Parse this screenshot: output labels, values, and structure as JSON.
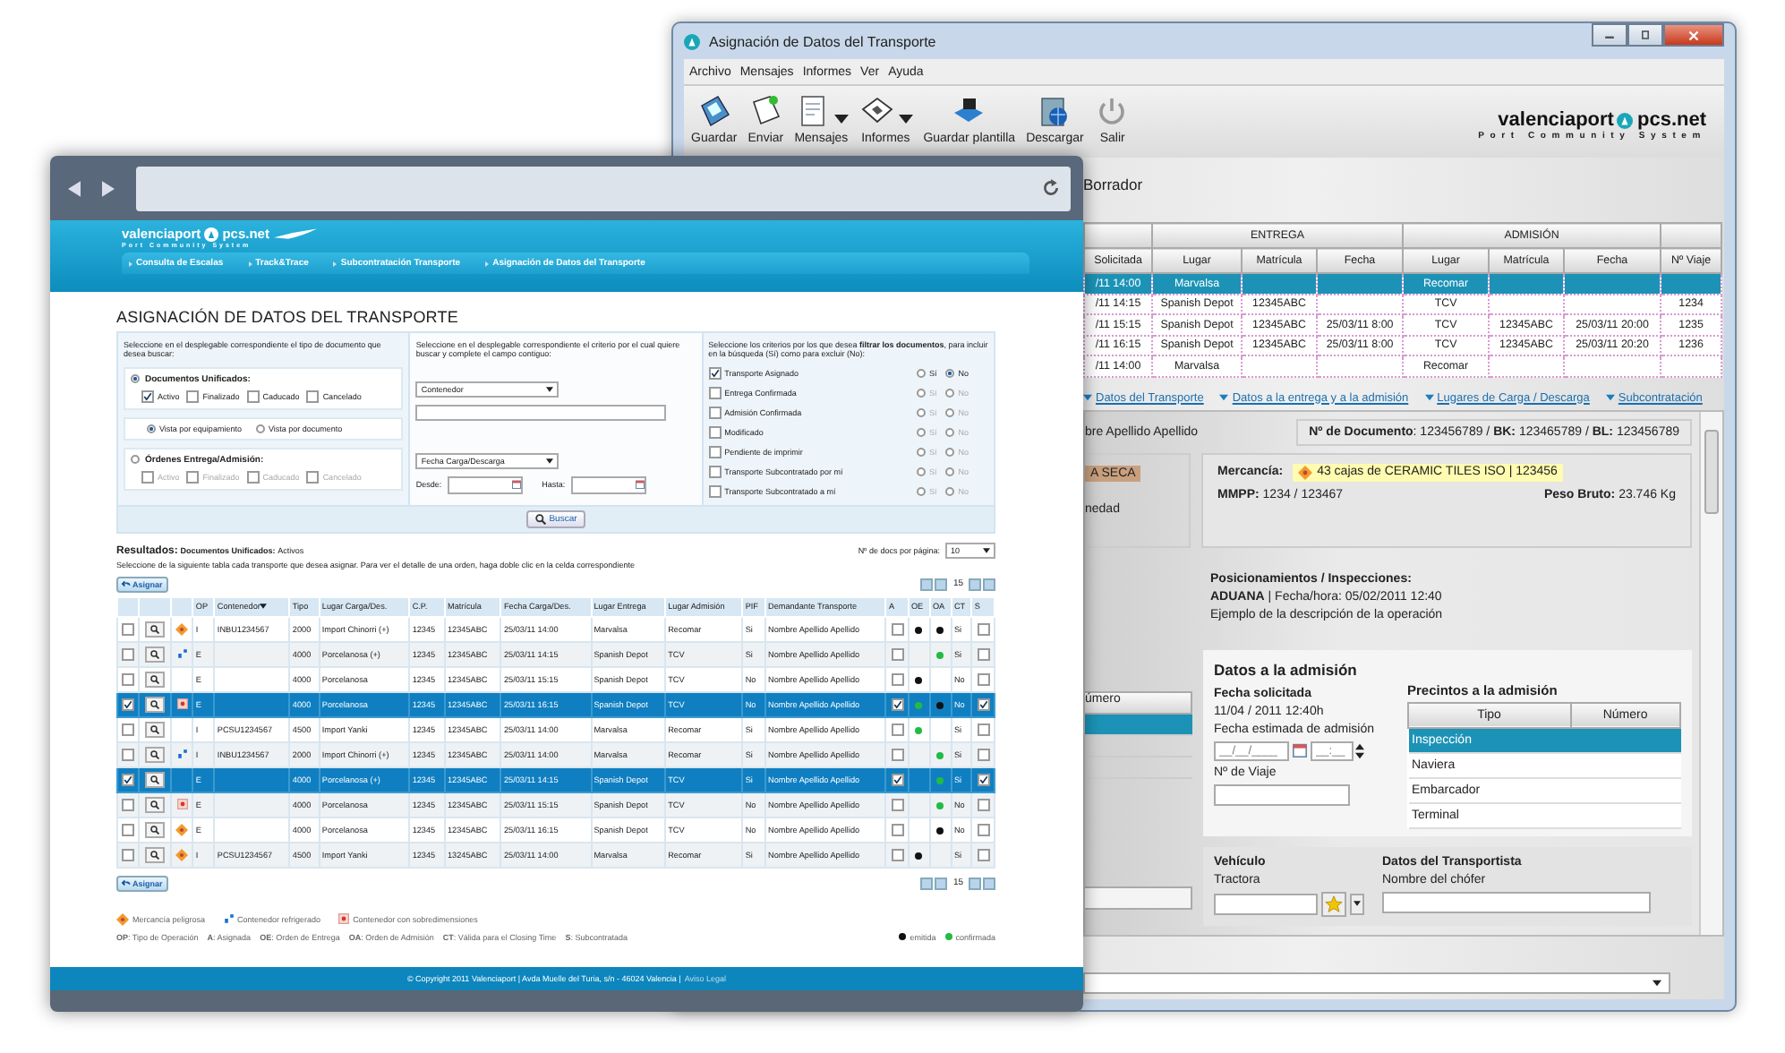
{
  "back_window": {
    "title": "Asignación de Datos del Transporte",
    "menu": [
      "Archivo",
      "Mensajes",
      "Informes",
      "Ver",
      "Ayuda"
    ],
    "toolbar": [
      {
        "label": "Guardar",
        "kind": "save",
        "dropdown": false
      },
      {
        "label": "Enviar",
        "kind": "send",
        "dropdown": false
      },
      {
        "label": "Mensajes",
        "kind": "messages",
        "dropdown": true
      },
      {
        "label": "Informes",
        "kind": "reports",
        "dropdown": true
      },
      {
        "label": "Guardar plantilla",
        "kind": "template",
        "dropdown": false
      },
      {
        "label": "Descargar",
        "kind": "download",
        "dropdown": false
      },
      {
        "label": "Salir",
        "kind": "exit",
        "dropdown": false
      }
    ],
    "logo": {
      "name": "valenciaport",
      "domain": "pcs.net",
      "tagline": "Port Community System"
    },
    "status": "Borrador",
    "table": {
      "groups": [
        "ENTREGA",
        "ADMISIÓN"
      ],
      "columns": [
        "Solicitada",
        "Lugar",
        "Matrícula",
        "Fecha",
        "Lugar",
        "Matrícula",
        "Fecha",
        "Nº Viaje"
      ],
      "rows": [
        {
          "selected": true,
          "cells": [
            "/11 14:00",
            "Marvalsa",
            null,
            null,
            "Recomar",
            null,
            null,
            null
          ]
        },
        {
          "selected": false,
          "cells": [
            "/11 14:15",
            "Spanish Depot",
            "12345ABC",
            null,
            "TCV",
            null,
            null,
            "1234"
          ]
        },
        {
          "selected": false,
          "cells": [
            "/11 15:15",
            "Spanish Depot",
            "12345ABC",
            "25/03/11 8:00",
            "TCV",
            "12345ABC",
            "25/03/11 20:00",
            "1235"
          ]
        },
        {
          "selected": false,
          "cells": [
            "/11 16:15",
            "Spanish Depot",
            "12345ABC",
            "25/03/11 8:00",
            "TCV",
            "12345ABC",
            "25/03/11 20:20",
            "1236"
          ]
        },
        {
          "selected": false,
          "cells": [
            "/11 14:00",
            "Marvalsa",
            null,
            null,
            "Recomar",
            null,
            null,
            null
          ]
        }
      ]
    },
    "links": [
      "Datos del Transporte",
      "Datos a la entrega y a la admisión",
      "Lugares de Carga / Descarga",
      "Subcontratación"
    ],
    "requester": "bre Apellido Apellido",
    "document": "**Nº de Documento**: 123456789 / **BK:** 123465789 / **BL:** 123456789",
    "tag": "A SECA",
    "side_text": "nedad",
    "goods": {
      "label": "Mercancía:",
      "value": "43 cajas de CERAMIC TILES ISO | 123456",
      "mmpp": "**MMPP:** 1234 / 123467",
      "weight": "**Peso Bruto:** 23.746 Kg"
    },
    "positions": {
      "title": "Posicionamientos / Inspecciones:",
      "line": "**ADUANA** | Fecha/hora: 05/02/2011 12:40",
      "description": "Ejemplo de la descripción de la operación"
    },
    "side_table": {
      "header": "úmero",
      "rows": [
        {
          "selected": true
        },
        {
          "selected": false
        },
        {
          "selected": false
        }
      ]
    },
    "admission": {
      "title": "Datos a la admisión",
      "requested_label": "Fecha solicitada",
      "requested": "11/04 / 2011 12:40h",
      "estimated_label": "Fecha estimada de admisión",
      "date_placeholder": "__/__/____",
      "time_placeholder": "__:__",
      "voyage_label": "Nº de Viaje",
      "seals": {
        "title": "Precintos a la admisión",
        "columns": [
          "Tipo",
          "Número"
        ],
        "rows": [
          {
            "label": "Inspección",
            "selected": true
          },
          {
            "label": "Naviera",
            "selected": false
          },
          {
            "label": "Embarcador",
            "selected": false
          },
          {
            "label": "Terminal",
            "selected": false
          }
        ]
      }
    },
    "vehicle": {
      "title": "Vehículo",
      "tractor_label": "Tractora",
      "carrier_title": "Datos del Transportista",
      "driver_label": "Nombre del chófer"
    }
  },
  "front_window": {
    "logo": {
      "name": "valenciaport",
      "domain": "pcs.net",
      "tagline": "Port Community System"
    },
    "nav": [
      "Consulta de Escalas",
      "Track&Trace",
      "Subcontratación Transporte",
      "Asignación de Datos del Transporte"
    ],
    "title": "ASIGNACIÓN DE DATOS DEL TRANSPORTE",
    "search": {
      "doc_hint": "Seleccione en el desplegable correspondiente el tipo de documento que desea buscar:",
      "groups": [
        {
          "label": "Documentos Unificados:",
          "selected": true,
          "options": [
            {
              "label": "Activo",
              "checked": true
            },
            {
              "label": "Finalizado",
              "checked": false
            },
            {
              "label": "Caducado",
              "checked": false
            },
            {
              "label": "Cancelado",
              "checked": false
            }
          ]
        },
        {
          "label": "Órdenes Entrega/Admisión:",
          "selected": false,
          "options": [
            {
              "label": "Activo",
              "checked": false
            },
            {
              "label": "Finalizado",
              "checked": false
            },
            {
              "label": "Caducado",
              "checked": false
            },
            {
              "label": "Cancelado",
              "checked": false
            }
          ]
        }
      ],
      "views": [
        {
          "label": "Vista por equipamiento",
          "selected": true
        },
        {
          "label": "Vista por documento",
          "selected": false
        }
      ],
      "criteria_hint": "Seleccione en el desplegable correspondiente el criterio por el cual quiere buscar y complete el campo contiguo:",
      "field_select": "Contenedor",
      "date_select": "Fecha Carga/Descarga",
      "from_label": "Desde:",
      "to_label": "Hasta:",
      "filter_hint": "Seleccione los criterios por los que desea **filtrar los documentos**, para incluir en la búsqueda (Sí) como para excluir (No):",
      "filters": [
        {
          "label": "Transporte Asignado",
          "checked": true,
          "options": [
            {
              "label": "Sí",
              "selected": false
            },
            {
              "label": "No",
              "selected": true
            }
          ]
        },
        {
          "label": "Entrega Confirmada",
          "checked": false,
          "options": [
            {
              "label": "Sí",
              "selected": false
            },
            {
              "label": "No",
              "selected": false
            }
          ]
        },
        {
          "label": "Admisión Confirmada",
          "checked": false,
          "options": [
            {
              "label": "Sí",
              "selected": false
            },
            {
              "label": "No",
              "selected": false
            }
          ]
        },
        {
          "label": "Modificado",
          "checked": false,
          "options": [
            {
              "label": "Sí",
              "selected": false
            },
            {
              "label": "No",
              "selected": false
            }
          ]
        },
        {
          "label": "Pendiente de imprimir",
          "checked": false,
          "options": [
            {
              "label": "Sí",
              "selected": false
            },
            {
              "label": "No",
              "selected": false
            }
          ]
        },
        {
          "label": "Transporte Subcontratado por mí",
          "checked": false,
          "options": [
            {
              "label": "Sí",
              "selected": false
            },
            {
              "label": "No",
              "selected": false
            }
          ]
        },
        {
          "label": "Transporte Subcontratado a mí",
          "checked": false,
          "options": [
            {
              "label": "Sí",
              "selected": false
            },
            {
              "label": "No",
              "selected": false
            }
          ]
        }
      ],
      "button": "Buscar"
    },
    "results": {
      "label": "Resultados:",
      "doc_type": "Documentos Unificados:",
      "state": "Activos",
      "instructions": "Seleccione de la siguiente tabla cada transporte que desea asignar. Para ver el detalle de una orden, haga doble clic en la celda correspondiente",
      "per_page_label": "Nº de docs por página:",
      "per_page": "10",
      "assign": [
        "Asignar",
        "Asignar"
      ],
      "pages": [
        "15",
        "15"
      ],
      "columns": [
        {
          "label": "OP",
          "sorted": false
        },
        {
          "label": "Contenedor",
          "sorted": true
        },
        {
          "label": "Tipo",
          "sorted": false
        },
        {
          "label": "Lugar Carga/Des.",
          "sorted": false
        },
        {
          "label": "C.P.",
          "sorted": false
        },
        {
          "label": "Matrícula",
          "sorted": false
        },
        {
          "label": "Fecha Carga/Des.",
          "sorted": false
        },
        {
          "label": "Lugar Entrega",
          "sorted": false
        },
        {
          "label": "Lugar Admisión",
          "sorted": false
        },
        {
          "label": "PIF",
          "sorted": false
        },
        {
          "label": "Demandante Transporte",
          "sorted": false
        },
        {
          "label": "A",
          "sorted": false
        },
        {
          "label": "OE",
          "sorted": false
        },
        {
          "label": "OA",
          "sorted": false
        },
        {
          "label": "CT",
          "sorted": false
        },
        {
          "label": "S",
          "sorted": false
        }
      ],
      "rows": [
        {
          "selected": false,
          "checked": false,
          "cargo": {
            "kind": "dangerous"
          },
          "op": "I",
          "container": "INBU1234567",
          "type": "2000",
          "load": "Import Chinorri (+)",
          "cp": "12345",
          "plate": "12345ABC",
          "date": "25/03/11 14:00",
          "delivery": "Marvalsa",
          "admission": "Recomar",
          "pif": "Si",
          "requester": "Nombre Apellido Apellido",
          "a": false,
          "oe": {
            "color": "#111111"
          },
          "oa": {
            "color": "#111111"
          },
          "ct": "Si",
          "s": false
        },
        {
          "selected": false,
          "checked": false,
          "cargo": {
            "kind": "reefer"
          },
          "op": "E",
          "type": "4000",
          "load": "Porcelanosa (+)",
          "cp": "12345",
          "plate": "12345ABC",
          "date": "25/03/11 14:15",
          "delivery": "Spanish Depot",
          "admission": "TCV",
          "pif": "Si",
          "requester": "Nombre Apellido Apellido",
          "a": false,
          "oa": {
            "color": "#22bb44"
          },
          "ct": "Si",
          "s": false
        },
        {
          "selected": false,
          "checked": false,
          "op": "E",
          "type": "4000",
          "load": "Porcelanosa",
          "cp": "12345",
          "plate": "12345ABC",
          "date": "25/03/11 15:15",
          "delivery": "Spanish Depot",
          "admission": "TCV",
          "pif": "No",
          "requester": "Nombre Apellido Apellido",
          "a": false,
          "oe": {
            "color": "#111111"
          },
          "ct": "No",
          "s": false
        },
        {
          "selected": true,
          "checked": true,
          "cargo": {
            "kind": "oversize"
          },
          "op": "E",
          "type": "4000",
          "load": "Porcelanosa",
          "cp": "12345",
          "plate": "12345ABC",
          "date": "25/03/11 16:15",
          "delivery": "Spanish Depot",
          "admission": "TCV",
          "pif": "No",
          "requester": "Nombre Apellido Apellido",
          "a": true,
          "oe": {
            "color": "#22bb44"
          },
          "oa": {
            "color": "#111111"
          },
          "ct": "No",
          "s": true
        },
        {
          "selected": false,
          "checked": false,
          "op": "I",
          "container": "PCSU1234567",
          "type": "4500",
          "load": "Import Yanki",
          "cp": "12345",
          "plate": "12345ABC",
          "date": "25/03/11 14:00",
          "delivery": "Marvalsa",
          "admission": "Recomar",
          "pif": "Si",
          "requester": "Nombre Apellido Apellido",
          "a": false,
          "oe": {
            "color": "#22bb44"
          },
          "ct": "Si",
          "s": false
        },
        {
          "selected": false,
          "checked": false,
          "cargo": {
            "kind": "reefer"
          },
          "op": "I",
          "container": "INBU1234567",
          "type": "2000",
          "load": "Import Chinorri (+)",
          "cp": "12345",
          "plate": "12345ABC",
          "date": "25/03/11 14:00",
          "delivery": "Marvalsa",
          "admission": "Recomar",
          "pif": "Si",
          "requester": "Nombre Apellido Apellido",
          "a": false,
          "oa": {
            "color": "#22bb44"
          },
          "ct": "Si",
          "s": false
        },
        {
          "selected": true,
          "checked": true,
          "op": "E",
          "type": "4000",
          "load": "Porcelanosa (+)",
          "cp": "12345",
          "plate": "12345ABC",
          "date": "25/03/11 14:15",
          "delivery": "Spanish Depot",
          "admission": "TCV",
          "pif": "Si",
          "requester": "Nombre Apellido Apellido",
          "a": true,
          "oa": {
            "color": "#22bb44"
          },
          "ct": "Si",
          "s": true
        },
        {
          "selected": false,
          "checked": false,
          "cargo": {
            "kind": "oversize"
          },
          "op": "E",
          "type": "4000",
          "load": "Porcelanosa",
          "cp": "12345",
          "plate": "12345ABC",
          "date": "25/03/11 15:15",
          "delivery": "Spanish Depot",
          "admission": "TCV",
          "pif": "No",
          "requester": "Nombre Apellido Apellido",
          "a": false,
          "oa": {
            "color": "#22bb44"
          },
          "ct": "No",
          "s": false
        },
        {
          "selected": false,
          "checked": false,
          "cargo": {
            "kind": "dangerous"
          },
          "op": "E",
          "type": "4000",
          "load": "Porcelanosa",
          "cp": "12345",
          "plate": "12345ABC",
          "date": "25/03/11 16:15",
          "delivery": "Spanish Depot",
          "admission": "TCV",
          "pif": "No",
          "requester": "Nombre Apellido Apellido",
          "a": false,
          "oa": {
            "color": "#111111"
          },
          "ct": "No",
          "s": false
        },
        {
          "selected": false,
          "checked": false,
          "cargo": {
            "kind": "dangerous"
          },
          "op": "I",
          "container": "PCSU1234567",
          "type": "4500",
          "load": "Import Yanki",
          "cp": "12345",
          "plate": "13245ABC",
          "date": "25/03/11 14:00",
          "delivery": "Marvalsa",
          "admission": "Recomar",
          "pif": "Si",
          "requester": "Nombre Apellido Apellido",
          "a": false,
          "oe": {
            "color": "#111111"
          },
          "ct": "Si",
          "s": false
        }
      ],
      "legend": [
        {
          "kind": "dangerous",
          "label": "Mercancía peligrosa"
        },
        {
          "kind": "reefer",
          "label": "Contenedor refrigerado"
        },
        {
          "kind": "oversize",
          "label": "Contenedor con sobredimensiones"
        }
      ],
      "abbreviations": [
        "**OP**: Tipo de Operación",
        "**A**: Asignada",
        "**OE**: Orden de Entrega",
        "**OA**: Orden de Admisión",
        "**CT**: Válida para el Closing Time",
        "**S**: Subcontratada"
      ],
      "dots": [
        {
          "label": "emitida",
          "color": "#111111"
        },
        {
          "label": "confirmada",
          "color": "#22bb44"
        }
      ]
    },
    "footer": {
      "text": "© Copyright 2011 Valenciaport | Avda Muelle del Turia, s/n - 46024 Valencia |",
      "link": "Aviso Legal"
    }
  }
}
